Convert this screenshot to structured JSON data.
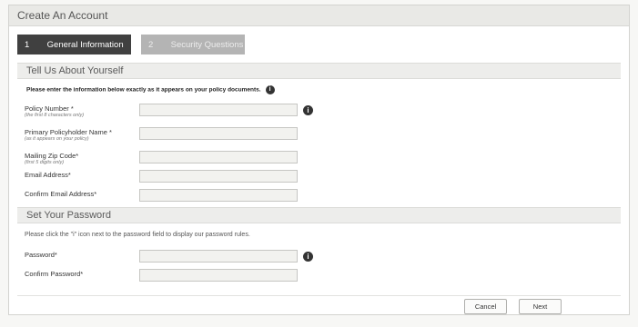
{
  "window": {
    "title": "Create An Account"
  },
  "steps": [
    {
      "number": "1",
      "label": "General Information",
      "active": true
    },
    {
      "number": "2",
      "label": "Security Questions",
      "active": false
    }
  ],
  "about": {
    "header": "Tell Us About Yourself",
    "instruction": "Please enter the information below exactly as it appears on your policy documents.",
    "fields": [
      {
        "label": "Policy Number *",
        "hint": "(the first 8 characters only)",
        "value": "",
        "placeholder": ""
      },
      {
        "label": "Primary Policyholder Name *",
        "hint": "(as it appears on your policy)",
        "value": "",
        "placeholder": ""
      },
      {
        "label": "Mailing Zip Code*",
        "hint": "(first 5 digits only)",
        "value": "",
        "placeholder": ""
      },
      {
        "label": "Email Address*",
        "hint": "",
        "value": "",
        "placeholder": ""
      },
      {
        "label": "Confirm Email Address*",
        "hint": "",
        "value": "",
        "placeholder": ""
      }
    ]
  },
  "password": {
    "header": "Set Your Password",
    "instruction": "Please click the \"i\" icon next to the password field to display our password rules.",
    "fields": [
      {
        "label": "Password*",
        "value": "",
        "placeholder": ""
      },
      {
        "label": "Confirm Password*",
        "value": "",
        "placeholder": ""
      }
    ]
  },
  "buttons": {
    "cancel": "Cancel",
    "next": "Next"
  },
  "icons": {
    "info": "info-icon",
    "info_glyph": "i"
  },
  "colors": {
    "active_step": "#404040",
    "inactive_step": "#b4b4b4",
    "section_bg": "#ededeb"
  }
}
